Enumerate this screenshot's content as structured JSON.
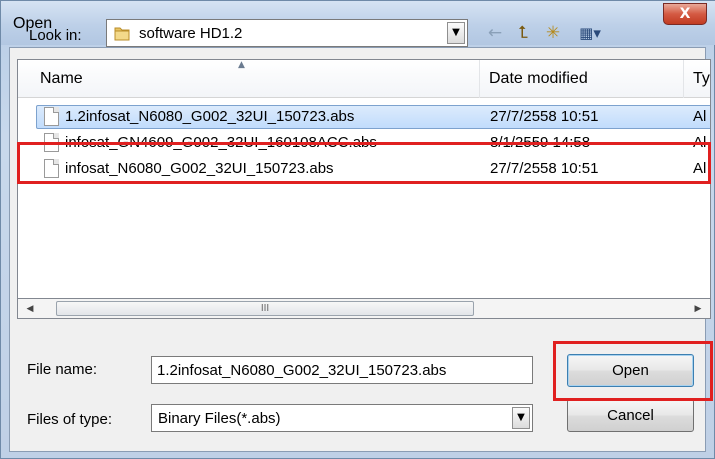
{
  "window": {
    "title": "Open",
    "close_symbol": "X"
  },
  "look_in": {
    "label": "Look in:",
    "value": "software HD1.2",
    "arrow": "▼"
  },
  "toolbar": {
    "icons": [
      "back-arrow-icon",
      "up-folder-icon",
      "new-folder-icon",
      "view-menu-icon"
    ],
    "back_glyph": "←",
    "up_glyph": "⮤",
    "new_glyph": "✳",
    "view_glyph": "▦▾"
  },
  "columns": {
    "name": "Name",
    "date": "Date modified",
    "type": "Ty"
  },
  "files": [
    {
      "name": "1.2infosat_N6080_G002_32UI_150723.abs",
      "date": "27/7/2558 10:51",
      "type": "Al",
      "selected": true
    },
    {
      "name": "infosat_GN4609_G002_32UI_160108ACC.abs",
      "date": "8/1/2559 14:58",
      "type": "Al",
      "selected": false
    },
    {
      "name": "infosat_N6080_G002_32UI_150723.abs",
      "date": "27/7/2558 10:51",
      "type": "Al",
      "selected": false
    }
  ],
  "scrollbar": {
    "left_arrow": "◀",
    "right_arrow": "▶",
    "grip": "III"
  },
  "file_name": {
    "label": "File name:",
    "value": "1.2infosat_N6080_G002_32UI_150723.abs"
  },
  "file_type": {
    "label": "Files of type:",
    "value": "Binary Files(*.abs)",
    "arrow": "▼"
  },
  "buttons": {
    "open": "Open",
    "cancel": "Cancel"
  },
  "colors": {
    "highlight_box": "#e02020",
    "selection": "#c1dcfc"
  }
}
